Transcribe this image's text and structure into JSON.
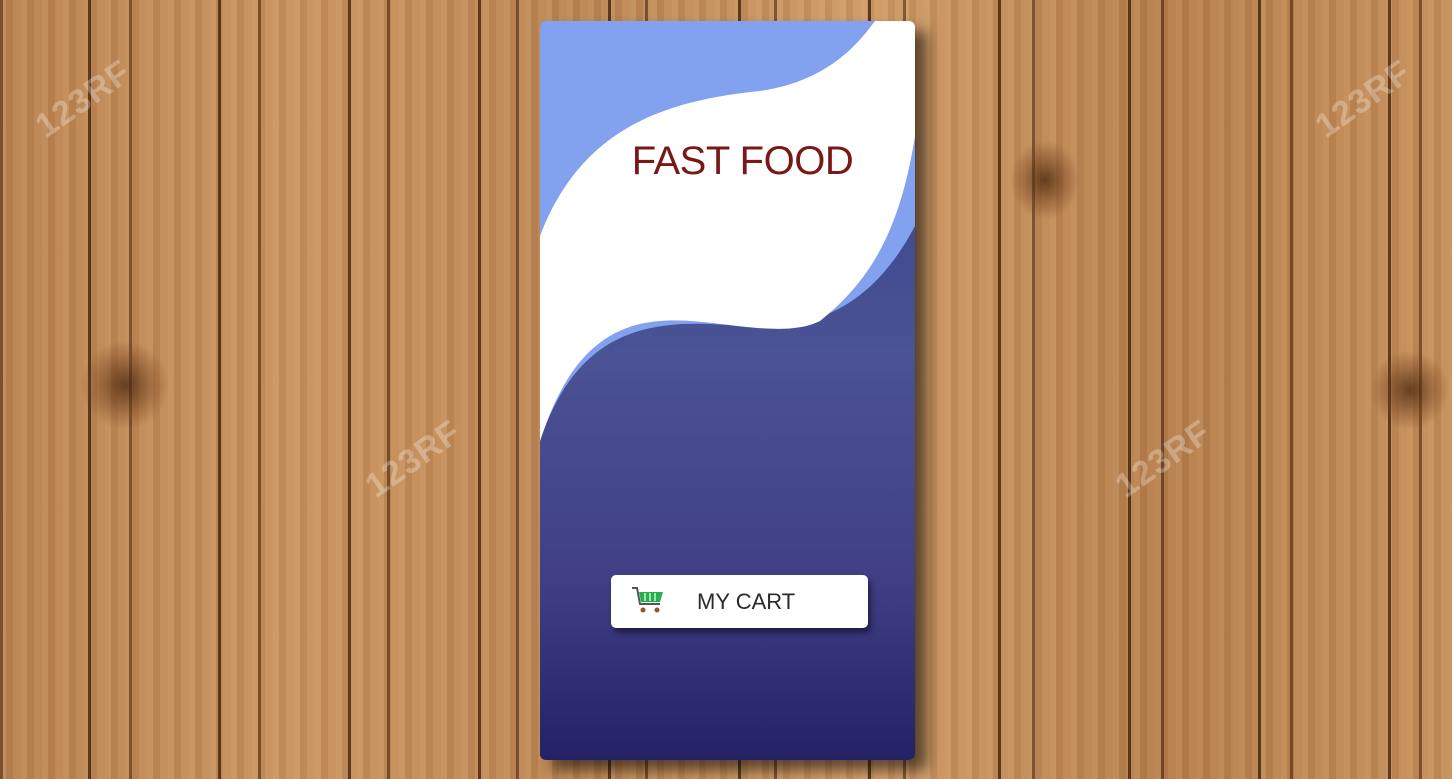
{
  "screen": {
    "title": "FAST FOOD",
    "cart_button": {
      "label": "MY CART",
      "icon": "shopping-cart-icon"
    }
  },
  "background": {
    "watermark_text": "123RF"
  },
  "colors": {
    "light_blue": "#82a2f0",
    "dark_blue_top": "#3b4a9a",
    "dark_blue_bottom": "#272466",
    "title_red": "#7a1818",
    "cart_green": "#22b14c"
  }
}
